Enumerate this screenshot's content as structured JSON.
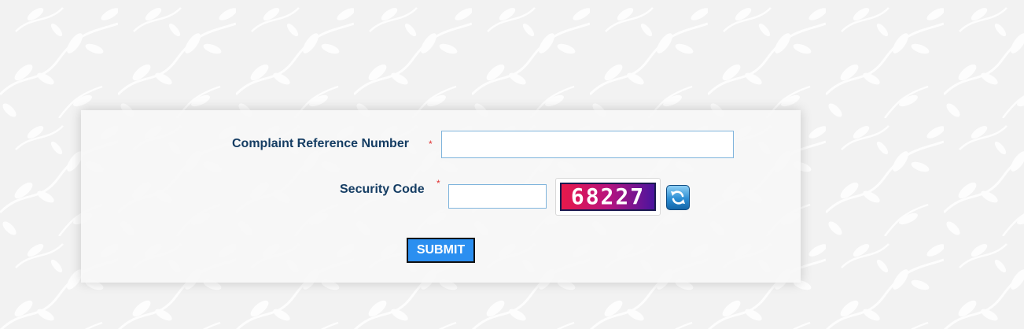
{
  "form": {
    "complaint_label": "Complaint Reference Number",
    "required_mark": "*",
    "complaint_value": "",
    "security_label": "Security Code",
    "security_value": "",
    "captcha_text": "68227",
    "refresh_icon": "refresh-icon",
    "submit_label": "SUBMIT"
  },
  "colors": {
    "label": "#153d63",
    "required": "#e03030",
    "field_border": "#7fb4dc",
    "submit_bg": "#2b8ff0",
    "page_bg": "#f2f2f2"
  }
}
